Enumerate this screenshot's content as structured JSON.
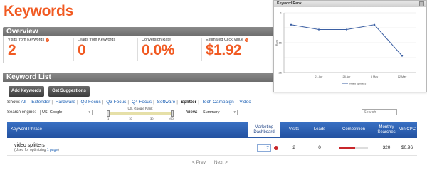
{
  "title": "Keywords",
  "overview": {
    "heading": "Overview",
    "stats": [
      {
        "label": "Visits from Keywords",
        "value": "2"
      },
      {
        "label": "Leads from Keywords",
        "value": "0"
      },
      {
        "label": "Conversion Rate",
        "value": "0.0%"
      },
      {
        "label": "Estimated Click Value",
        "value": "$1.92"
      }
    ]
  },
  "keyword_list": {
    "heading": "Keyword List",
    "add_button": "Add Keywords",
    "suggest_button": "Get Suggestions",
    "show_label": "Show:",
    "filters": [
      "All",
      "Extender",
      "Hardware",
      "Q2 Focus",
      "Q3 Focus",
      "Q4 Focus",
      "Software",
      "Splitter",
      "Tech Campaign",
      "Video"
    ],
    "active_filter": "Splitter",
    "search_engine_label": "Search engine:",
    "search_engine_value": "US, Google",
    "rank_slider": {
      "caption": "US, Google Rank",
      "ticks": [
        "1",
        "10",
        "30",
        ">50"
      ]
    },
    "view_label": "View:",
    "view_value": "Summary",
    "search_placeholder": "Search"
  },
  "table": {
    "columns": {
      "phrase": "Keyword Phrase",
      "dashboard": "Marketing Dashboard",
      "visits": "Visits",
      "leads": "Leads",
      "competition": "Competition",
      "searches": "Monthly Searches",
      "cpc": "Min CPC"
    },
    "rows": [
      {
        "phrase": "video splitters",
        "used_prefix": "(Used for optimizing",
        "used_link": "1 page",
        "used_suffix": ")",
        "dashboard": "17",
        "visits": "2",
        "leads": "0",
        "competition": 0.55,
        "searches": "320",
        "cpc": "$0.96"
      }
    ]
  },
  "pager": {
    "prev": "< Prev",
    "next": "Next >"
  },
  "graph_popup": {
    "title": "Keyword Rank",
    "legend": "video splitters",
    "chart_data": {
      "type": "line",
      "title": "",
      "ylabel": "Rank",
      "yticks": [
        "1",
        "",
        "16",
        "",
        "26"
      ],
      "x_ticks": [
        "21 Apr",
        "28 Apr",
        "5 May",
        "12 May"
      ],
      "ylim": [
        1,
        26
      ],
      "series": [
        {
          "name": "video splitters",
          "x": [
            "14 Apr",
            "21 Apr",
            "28 Apr",
            "5 May",
            "12 May"
          ],
          "values": [
            6,
            8,
            8,
            6,
            19
          ]
        }
      ]
    }
  },
  "colors": {
    "accent": "#f15a22",
    "header_blue": "#2351a0",
    "link": "#1a5fb4",
    "danger": "#c8262b"
  }
}
